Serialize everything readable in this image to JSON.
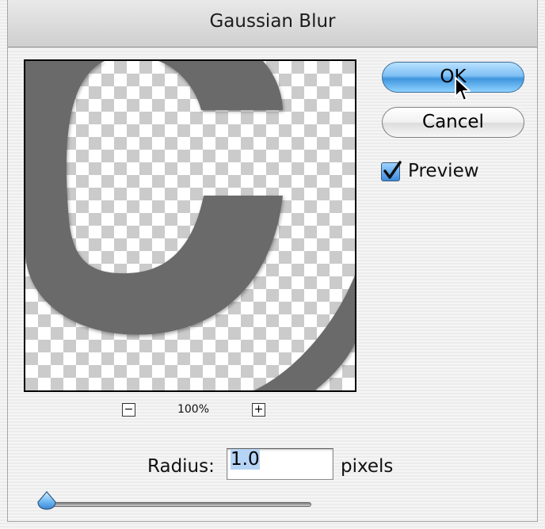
{
  "window": {
    "title": "Gaussian Blur"
  },
  "buttons": {
    "ok_label": "OK",
    "cancel_label": "Cancel"
  },
  "preview_option": {
    "label": "Preview",
    "checked": true
  },
  "zoom": {
    "minus_label": "−",
    "value": "100%",
    "plus_label": "+"
  },
  "radius": {
    "label": "Radius:",
    "value": "1.0",
    "unit": "pixels"
  },
  "slider": {
    "level": 0.03
  },
  "colors": {
    "accent": "#5aa9ec",
    "glyph_gray": "#6b6b6b",
    "checker": "#cbcbcb"
  },
  "icons": {
    "cursor": "arrow-pointer",
    "checkbox": "checkmark",
    "slider_thumb": "blue-droplet-thumb"
  }
}
